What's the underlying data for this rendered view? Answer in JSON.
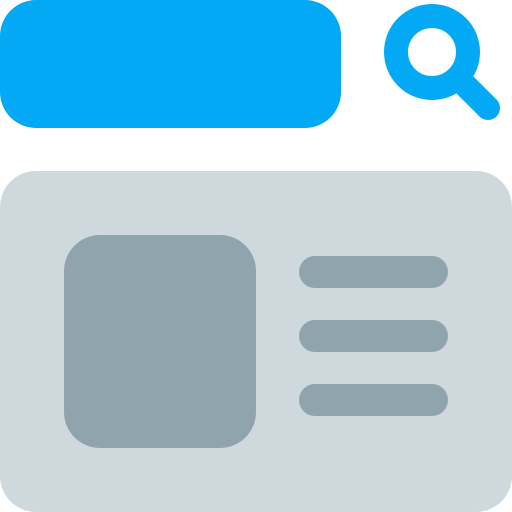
{
  "colors": {
    "background": "#FFFFFF",
    "accent": "#03A9F4",
    "card": "#CFD8DC",
    "placeholder": "#90A4AE"
  },
  "search": {
    "bar_icon": "search-bar-shape",
    "button_icon": "search-icon"
  },
  "card": {
    "thumbnail_icon": "image-placeholder-icon",
    "text_lines": [
      {
        "icon": "text-line-placeholder"
      },
      {
        "icon": "text-line-placeholder"
      },
      {
        "icon": "text-line-placeholder"
      }
    ]
  }
}
